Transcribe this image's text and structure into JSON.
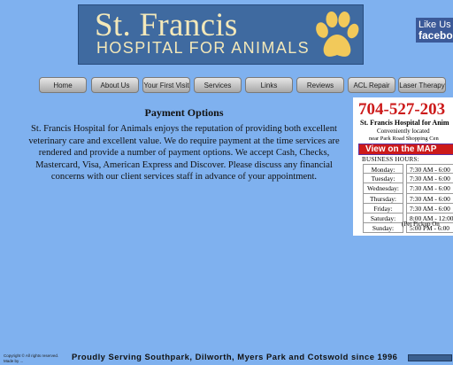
{
  "header": {
    "title": "St. Francis",
    "subtitle": "HOSPITAL FOR ANIMALS",
    "logo_icon": "paw-print-icon",
    "brand_color": "#3f6aa0",
    "accent_color": "#f3e8b9"
  },
  "facebook": {
    "line1": "Like Us o",
    "line2": "faceboo",
    "color": "#3b5998"
  },
  "nav": {
    "items": [
      {
        "label": "Home"
      },
      {
        "label": "About Us"
      },
      {
        "label": "Your First Visit"
      },
      {
        "label": "Services"
      },
      {
        "label": "Links"
      },
      {
        "label": "Reviews"
      },
      {
        "label": "ACL Repair"
      },
      {
        "label": "Laser Therapy"
      }
    ]
  },
  "content": {
    "heading": "Payment Options",
    "body": "St. Francis Hospital for Animals enjoys the reputation of providing both excellent veterinary care and excellent value. We do require payment at the time services are rendered and provide a number of payment options. We accept Cash, Checks, Mastercard, Visa, American Express and Discover. Please discuss any financial concerns with our client services staff in advance of your appointment."
  },
  "card": {
    "phone": "704-527-203",
    "name": "St. Francis Hospital for Anim",
    "location1": "Conveniently located",
    "location2": "near Park Road Shopping Cen",
    "map_button": "View on the MAP",
    "hours_title": "BUSINESS HOURS:",
    "hours": [
      {
        "day": "Monday:",
        "time": "7:30 AM - 6:00"
      },
      {
        "day": "Tuesday:",
        "time": "7:30 AM - 6:00"
      },
      {
        "day": "Wednesday:",
        "time": "7:30 AM - 6:00"
      },
      {
        "day": "Thursday:",
        "time": "7:30 AM - 6:00"
      },
      {
        "day": "Friday:",
        "time": "7:30 AM - 6:00"
      },
      {
        "day": "Saturday:",
        "time": "8:00 AM - 12:00"
      },
      {
        "day": "Sunday:",
        "time": "5:00 PM - 6:00"
      }
    ],
    "pickup_note": "(Pet Pickup On",
    "phone_color": "#cc1a1a"
  },
  "footer": {
    "copyright_line1": "Copyright © All rights reserved.",
    "copyright_line2": "Made by ...",
    "serving": "Proudly Serving Southpark, Dilworth, Myers Park and Cotswold since 1996"
  },
  "page_background": "#7fb1ef"
}
